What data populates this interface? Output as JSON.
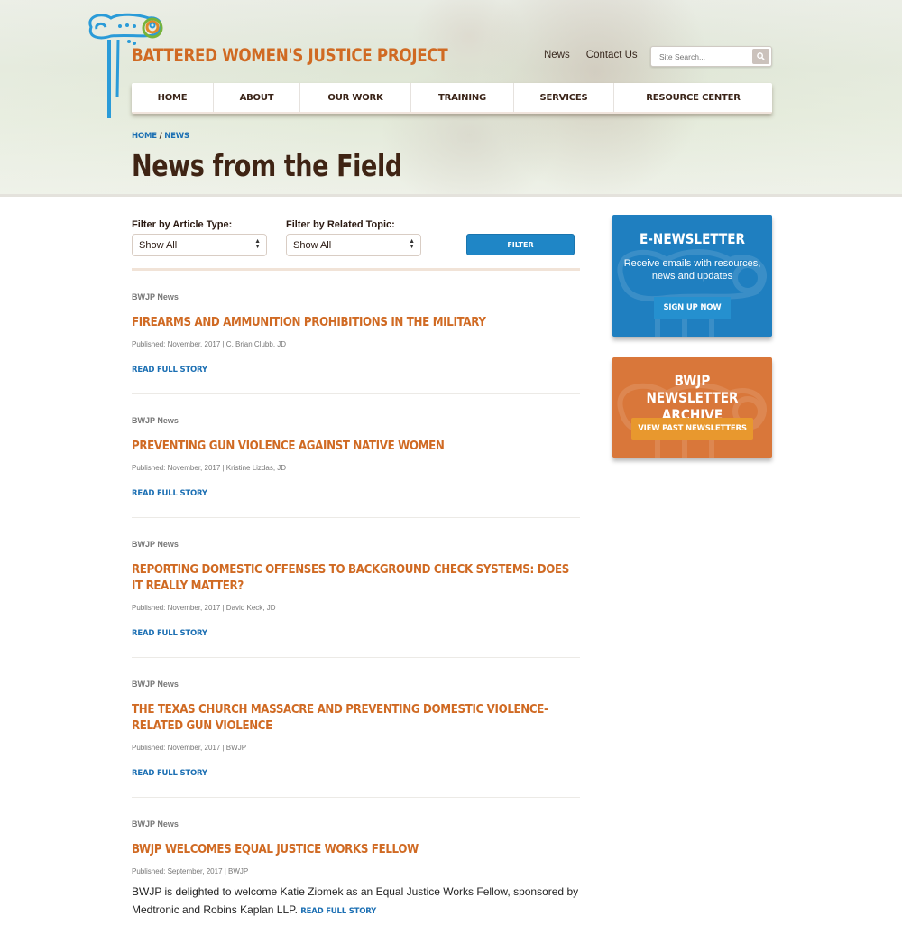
{
  "site": {
    "title": "BATTERED WOMEN'S JUSTICE PROJECT",
    "brand_orange": "#d06a23",
    "brand_blue": "#1f86c6",
    "brand_brown": "#3f2414"
  },
  "utility_nav": {
    "links": [
      "News",
      "Contact Us"
    ],
    "search_placeholder": "Site Search...",
    "search_icon": "search-icon"
  },
  "main_nav": {
    "items": [
      "HOME",
      "ABOUT",
      "OUR WORK",
      "TRAINING",
      "SERVICES",
      "RESOURCE CENTER"
    ]
  },
  "breadcrumb": {
    "items": [
      "HOME",
      "NEWS"
    ],
    "separator": "/"
  },
  "page_title": "News from the Field",
  "filters": {
    "article_type_label": "Filter by Article Type:",
    "article_type_value": "Show All",
    "topic_label": "Filter by Related Topic:",
    "topic_value": "Show All",
    "button_label": "FILTER"
  },
  "articles": [
    {
      "category": "BWJP News",
      "title": "FIREARMS AND AMMUNITION PROHIBITIONS IN THE MILITARY",
      "meta": "Published: November, 2017  |   C. Brian Clubb, JD",
      "read_more": "READ FULL STORY"
    },
    {
      "category": "BWJP News",
      "title": "PREVENTING GUN VIOLENCE AGAINST NATIVE WOMEN",
      "meta": "Published: November, 2017  |   Kristine Lizdas, JD",
      "read_more": "READ FULL STORY"
    },
    {
      "category": "BWJP News",
      "title": "REPORTING DOMESTIC OFFENSES TO BACKGROUND CHECK SYSTEMS: DOES IT REALLY MATTER?",
      "meta": "Published: November, 2017  |   David Keck, JD",
      "read_more": "READ FULL STORY"
    },
    {
      "category": "BWJP News",
      "title": "THE TEXAS CHURCH MASSACRE AND PREVENTING DOMESTIC VIOLENCE-RELATED GUN VIOLENCE",
      "meta": "Published: November, 2017  |   BWJP",
      "read_more": "READ FULL STORY"
    },
    {
      "category": "BWJP News",
      "title": "BWJP WELCOMES EQUAL JUSTICE WORKS FELLOW",
      "meta": "Published: September, 2017  |   BWJP",
      "excerpt": "BWJP is delighted to welcome Katie Ziomek as an Equal Justice Works Fellow, sponsored by Medtronic and Robins Kaplan LLP.",
      "read_more": "READ FULL STORY"
    }
  ],
  "sidebar": {
    "newsletter": {
      "title": "E-NEWSLETTER",
      "text": "Receive emails with resources, news and updates",
      "button": "SIGN UP NOW",
      "color": "#1f7fc0"
    },
    "archive": {
      "title": "BWJP NEWSLETTER ARCHIVE",
      "button": "VIEW PAST NEWSLETTERS",
      "color": "#d9773a"
    }
  }
}
